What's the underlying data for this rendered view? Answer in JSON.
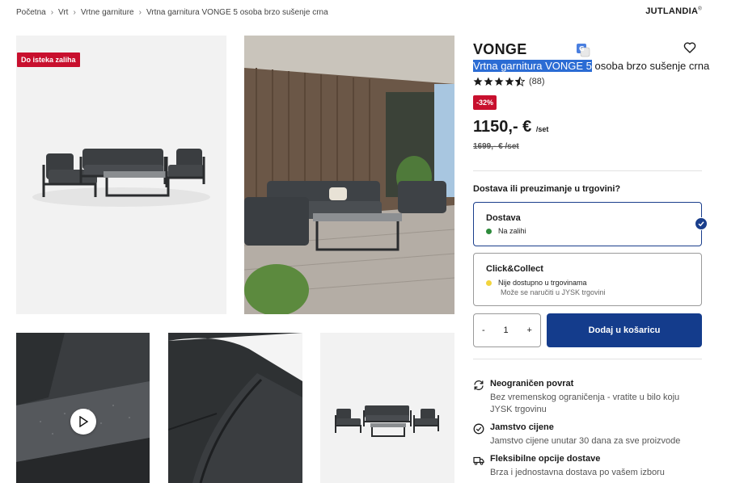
{
  "breadcrumb": {
    "items": [
      "Početna",
      "Vrt",
      "Vrtne garniture",
      "Vrtna garnitura VONGE 5 osoba brzo sušenje crna"
    ],
    "separator": "›"
  },
  "brand": {
    "name": "JUTLANDIA",
    "mark": "®"
  },
  "gallery": {
    "stock_badge": "Do isteka zaliha",
    "video_icon": "play-icon"
  },
  "product": {
    "title": "VONGE",
    "subtitle_highlight": "Vrtna garnitura VONGE 5",
    "subtitle_rest": " osoba brzo sušenje crna",
    "rating": 4.5,
    "review_count": "(88)",
    "discount": "-32%",
    "price": "1150,- €",
    "price_unit": "/set",
    "old_price": "1699,- € /set"
  },
  "delivery": {
    "heading": "Dostava ili preuzimanje u trgovini?",
    "options": [
      {
        "title": "Dostava",
        "status": "Na zalihi",
        "status_color": "#2e8b3c",
        "selected": true
      },
      {
        "title": "Click&Collect",
        "status": "Nije dostupno u trgovinama",
        "status_color": "#f2d43d",
        "note": "Može se naručiti u JYSK trgovini",
        "selected": false
      }
    ]
  },
  "cart": {
    "minus": "-",
    "quantity": "1",
    "plus": "+",
    "add_label": "Dodaj u košaricu"
  },
  "features": [
    {
      "icon": "refresh-icon",
      "title": "Neograničen povrat",
      "desc": "Bez vremenskog ograničenja - vratite u bilo koju JYSK trgovinu"
    },
    {
      "icon": "check-circle-icon",
      "title": "Jamstvo cijene",
      "desc": "Jamstvo cijene unutar 30 dana za sve proizvode"
    },
    {
      "icon": "truck-icon",
      "title": "Fleksibilne opcije dostave",
      "desc": "Brza i jednostavna dostava po vašem izboru"
    }
  ],
  "colors": {
    "accent": "#143c8c",
    "sale": "#c8102e",
    "highlight": "#2b6cd4"
  }
}
